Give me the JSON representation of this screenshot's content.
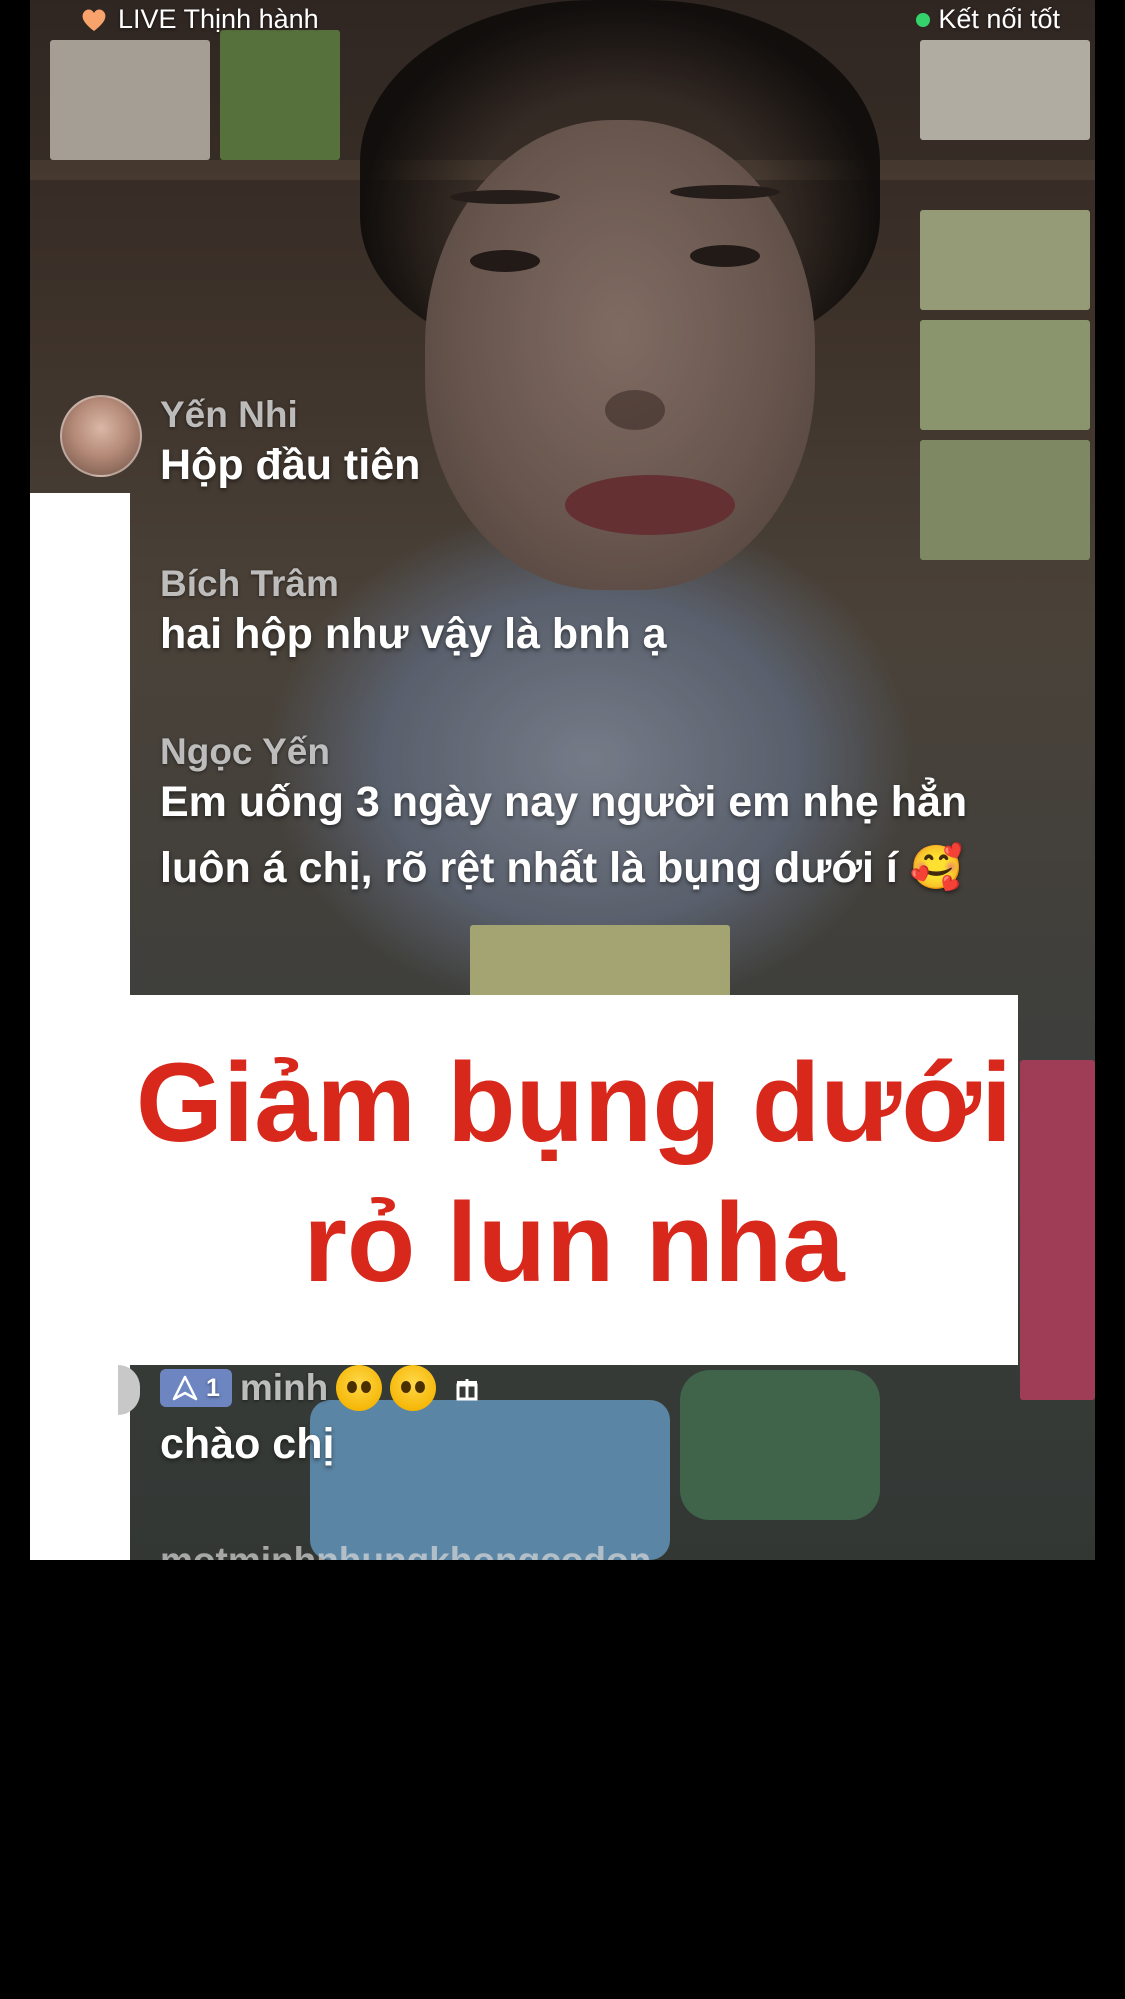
{
  "topbar": {
    "live_label": "LIVE Thịnh hành",
    "connection_label": "Kết nối tốt",
    "connection_color": "#34d36c"
  },
  "comments": [
    {
      "name": "Yến Nhi",
      "text": "Hộp đầu tiên"
    },
    {
      "name": "Bích Trâm",
      "text": "hai hộp như vậy là bnh ạ"
    },
    {
      "name": "Ngọc Yến",
      "text_line1": "Em uống 3 ngày nay người em nhẹ hẳn",
      "text_line2": "luôn á chị, rõ rệt nhất là bụng dưới í 🥰"
    },
    {
      "badge_level": "1",
      "name": "minh",
      "text": "chào chị"
    }
  ],
  "next_comment_name_partial": "motminhnhungkhongcodon",
  "caption": {
    "line1": "Giảm bụng dưới",
    "line2": "rỏ lun nha",
    "color": "#d8281c"
  }
}
